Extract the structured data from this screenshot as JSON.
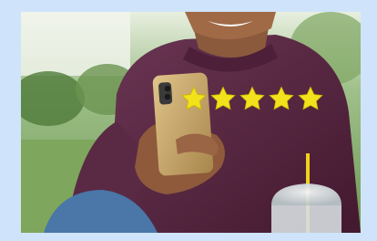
{
  "image": {
    "subject": "smiling-man-holding-smartphone",
    "rating": {
      "value": 5,
      "max": 5,
      "star_color": "#f2e21c"
    },
    "colors": {
      "frame": "#cfe4fa",
      "sweater": "#5a2a45",
      "jeans": "#4a76a8",
      "phone": "#c9a96a",
      "straw": "#f0d21c"
    }
  }
}
